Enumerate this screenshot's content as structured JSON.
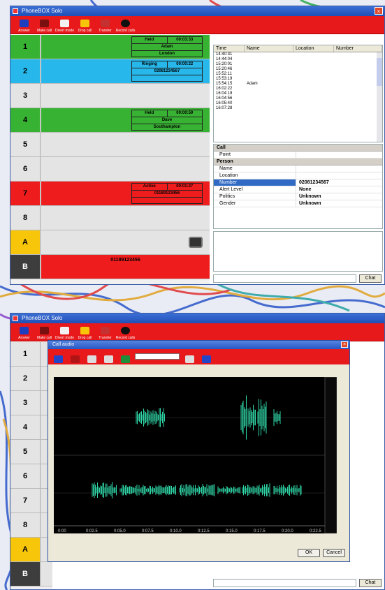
{
  "app": {
    "title": "PhoneBOX Solo"
  },
  "toolbar": {
    "buttons": [
      {
        "label": "Answer",
        "icon": "phone-icon"
      },
      {
        "label": "Make call",
        "icon": "keypad-icon"
      },
      {
        "label": "Divert mode",
        "icon": "divert-icon"
      },
      {
        "label": "Drop call",
        "icon": "drop-icon"
      },
      {
        "label": "Transfer",
        "icon": "transfer-icon"
      },
      {
        "label": "Record calls",
        "icon": "record-icon"
      }
    ]
  },
  "lines": [
    {
      "num": "1",
      "status": "Held",
      "time": "00:03:33",
      "line1": "Adam",
      "line2": "London"
    },
    {
      "num": "2",
      "status": "Ringing",
      "time": "00:00:22",
      "line1": "02081234567",
      "line2": ""
    },
    {
      "num": "3"
    },
    {
      "num": "4",
      "status": "Held",
      "time": "00:00:59",
      "line1": "Dave",
      "line2": "Southampton"
    },
    {
      "num": "5"
    },
    {
      "num": "6"
    },
    {
      "num": "7",
      "status": "Active",
      "time": "00:01:27",
      "line1": "01189123456",
      "line2": ""
    },
    {
      "num": "8"
    },
    {
      "num": "A"
    },
    {
      "num": "B",
      "line1": "01189123456"
    }
  ],
  "log": {
    "headers": [
      "Time",
      "Name",
      "Location",
      "Number"
    ],
    "rows": [
      {
        "time": "14:40:31",
        "name": ""
      },
      {
        "time": "14:44:04",
        "name": ""
      },
      {
        "time": "15:20:01",
        "name": ""
      },
      {
        "time": "15:20:46",
        "name": ""
      },
      {
        "time": "15:52:11",
        "name": ""
      },
      {
        "time": "15:53:19",
        "name": ""
      },
      {
        "time": "15:54:15",
        "name": "Adam"
      },
      {
        "time": "16:02:22",
        "name": ""
      },
      {
        "time": "16:04:19",
        "name": ""
      },
      {
        "time": "16:04:56",
        "name": ""
      },
      {
        "time": "16:05:40",
        "name": ""
      },
      {
        "time": "16:07:28",
        "name": ""
      }
    ]
  },
  "props": {
    "call_section": "Call",
    "call_rows": [
      {
        "k": "Point",
        "v": ""
      }
    ],
    "person_section": "Person",
    "person_rows": [
      {
        "k": "Name",
        "v": ""
      },
      {
        "k": "Location",
        "v": ""
      },
      {
        "k": "Number",
        "v": "02081234567"
      },
      {
        "k": "Alert Level",
        "v": "None"
      },
      {
        "k": "Politics",
        "v": "Unknown"
      },
      {
        "k": "Gender",
        "v": "Unknown"
      }
    ]
  },
  "chat": {
    "button": "Chat"
  },
  "dialog": {
    "title": "Call audio",
    "ok": "OK",
    "cancel": "Cancel",
    "time_ticks": [
      "0:00",
      "0:02.5",
      "0:05.0",
      "0:07.5",
      "0:10.0",
      "0:12.5",
      "0:15.0",
      "0:17.5",
      "0:20.0",
      "0:22.5"
    ]
  },
  "colors": {
    "held": "#38b233",
    "ringing": "#27b7ea",
    "active": "#ee1c1c",
    "toolbar": "#e8191b"
  }
}
